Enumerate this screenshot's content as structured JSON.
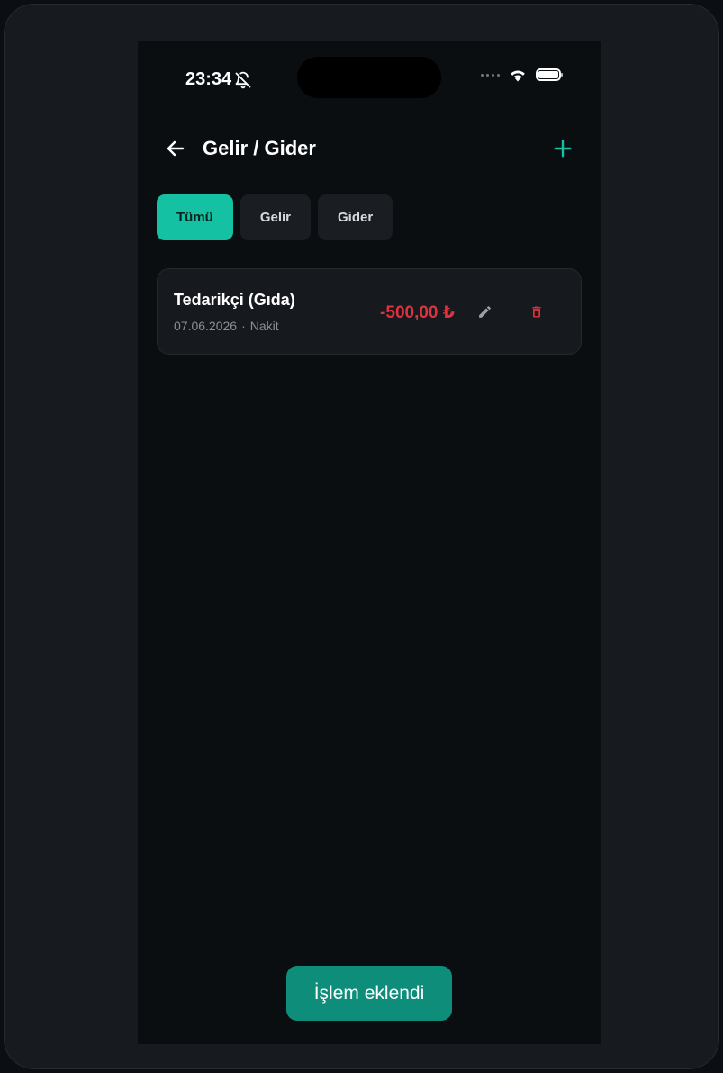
{
  "status_bar": {
    "time": "23:34",
    "icons": [
      "bell-off-icon",
      "cellular-dots-icon",
      "wifi-icon",
      "battery-icon"
    ]
  },
  "header": {
    "title": "Gelir / Gider",
    "back_icon": "arrow-left-icon",
    "add_icon": "plus-icon"
  },
  "tabs": [
    {
      "label": "Tümü",
      "active": true
    },
    {
      "label": "Gelir",
      "active": false
    },
    {
      "label": "Gider",
      "active": false
    }
  ],
  "transactions": [
    {
      "title": "Tedarikçi (Gıda)",
      "date": "07.06.2026",
      "separator": "·",
      "method": "Nakit",
      "amount": "-500,00 ₺"
    }
  ],
  "toast": {
    "message": "İşlem eklendi"
  },
  "colors": {
    "accent": "#14c2a3",
    "negative": "#e0323e",
    "toast": "#0e8d7b",
    "background": "#0b0e11"
  }
}
